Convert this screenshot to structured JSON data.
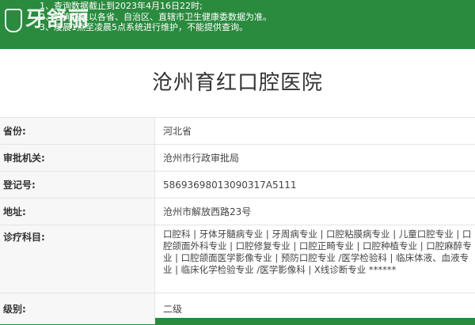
{
  "notice": {
    "logo_text": "牙舒丽",
    "lines": [
      "1、查询数据截止到2023年4月16日22时;",
      "2、查询结果以各省、自治区、直辖市卫生健康委数据为准。",
      "3、凌晨1点至凌晨5点系统进行维护，不能提供查询。"
    ]
  },
  "hospital": {
    "name": "沧州育红口腔医院"
  },
  "fields": {
    "province": {
      "label": "省份:",
      "value": "河北省"
    },
    "authority": {
      "label": "审批机关:",
      "value": "沧州市行政审批局"
    },
    "registration": {
      "label": "登记号:",
      "value": "58693698013090317A5111"
    },
    "address": {
      "label": "地址:",
      "value": "沧州市解放西路23号"
    },
    "departments": {
      "label": "诊疗科目:",
      "value": "口腔科 | 牙体牙髓病专业 | 牙周病专业 | 口腔粘膜病专业 | 儿童口腔专业 | 口腔颌面外科专业 | 口腔修复专业 | 口腔正畸专业 | 口腔种植专业 | 口腔麻醉专业 | 口腔颌面医学影像专业 | 预防口腔专业 /医学检验科 | 临床体液、血液专业 | 临床化学检验专业 /医学影像科 | X线诊断专业 ******"
    },
    "level": {
      "label": "级别:",
      "value": "二级"
    }
  },
  "colors": {
    "header_green": "#2a8a3e",
    "label_bg": "#f7f7f7",
    "border": "#e4e4e4"
  }
}
